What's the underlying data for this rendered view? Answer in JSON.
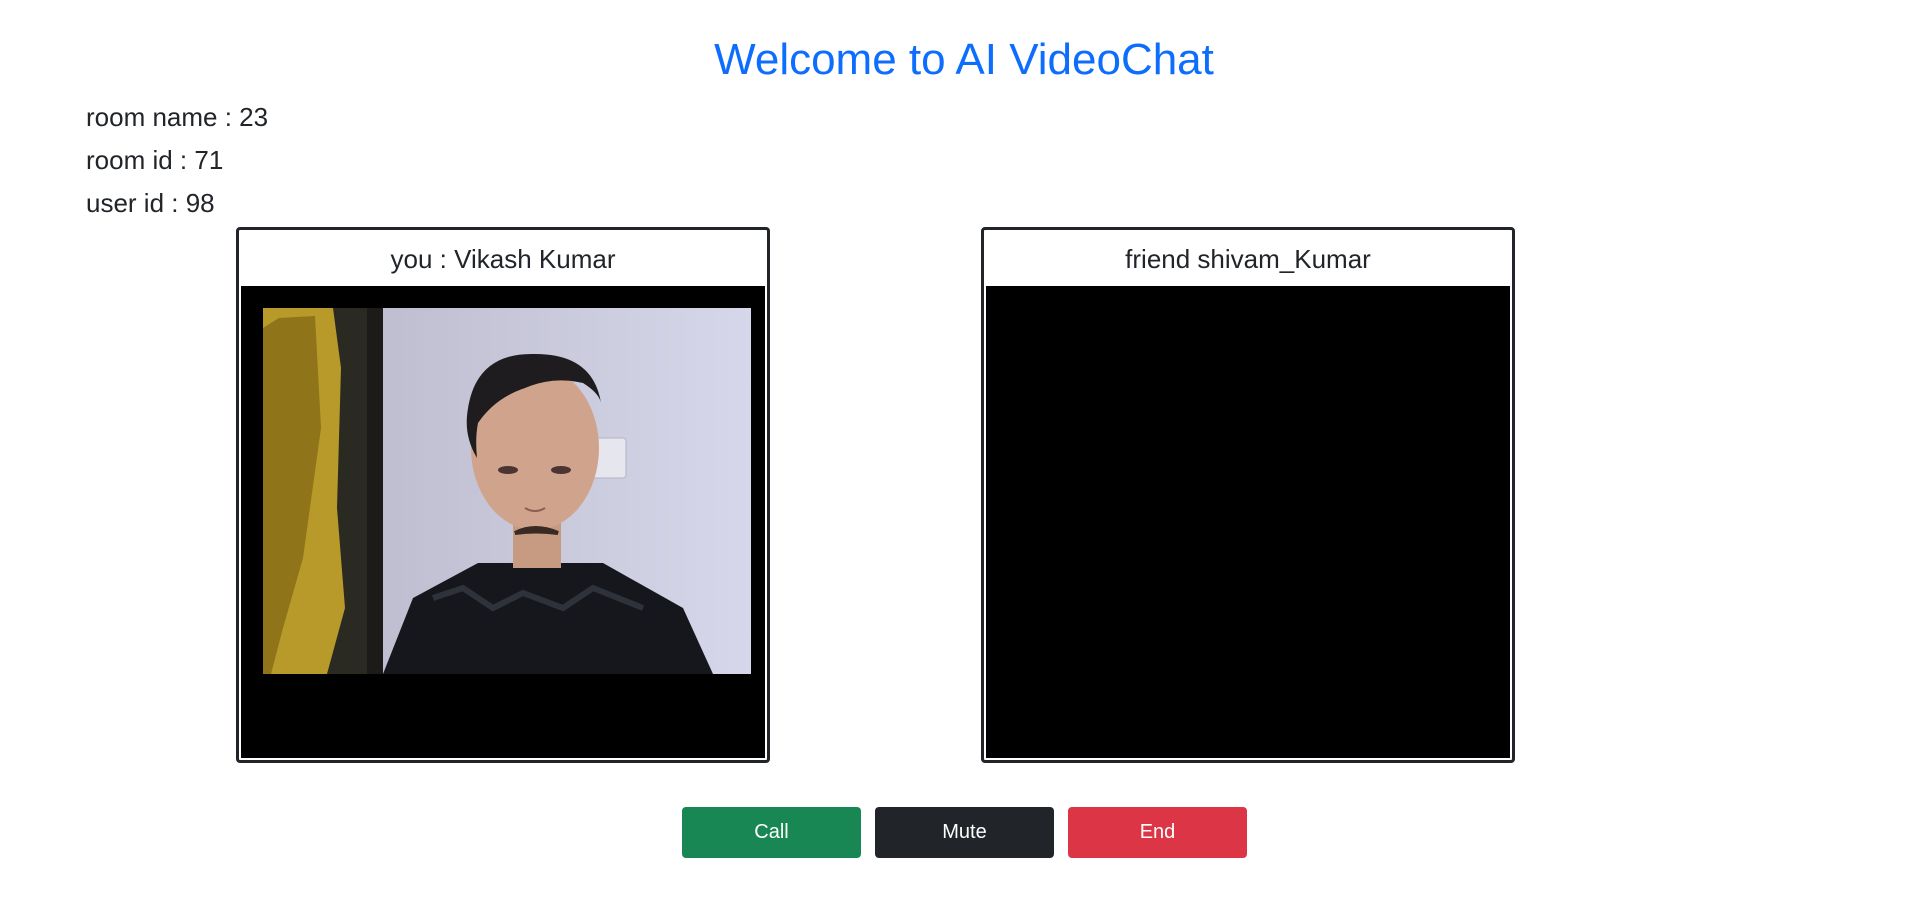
{
  "header": {
    "title": "Welcome to AI VideoChat"
  },
  "room": {
    "name_line": "room name : 23",
    "id_line": "room id : 71",
    "user_line": "user id : 98"
  },
  "videos": {
    "you_label": "you : Vikash Kumar",
    "friend_label": "friend shivam_Kumar"
  },
  "controls": {
    "call_label": "Call",
    "mute_label": "Mute",
    "end_label": "End"
  },
  "colors": {
    "title": "#0d6efd",
    "call": "#198754",
    "mute": "#212529",
    "end": "#dc3545"
  }
}
